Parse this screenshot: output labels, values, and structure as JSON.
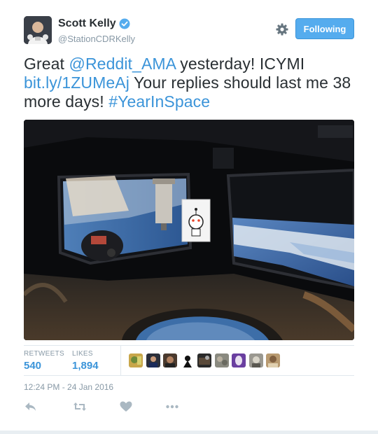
{
  "user": {
    "display_name": "Scott Kelly",
    "handle": "@StationCDRKelly",
    "verified_icon": "verified-badge-icon"
  },
  "header": {
    "settings_icon": "gear-icon",
    "follow_button_label": "Following"
  },
  "tweet": {
    "text_parts": [
      "Great ",
      "@Reddit_AMA",
      " yesterday! ICYMI ",
      "bit.ly/1ZUMeAj",
      " Your replies should last me 38 more days! ",
      "#YearInSpace"
    ]
  },
  "stats": {
    "retweets_label": "RETWEETS",
    "retweets_value": "540",
    "likes_label": "LIKES",
    "likes_value": "1,894"
  },
  "timestamp": "12:24 PM - 24 Jan 2016",
  "actions": [
    "reply-icon",
    "retweet-icon",
    "like-icon",
    "more-icon"
  ],
  "colors": {
    "link": "#3b94d9",
    "follow_button": "#55acee",
    "muted": "#8899a6",
    "text": "#292f33"
  }
}
